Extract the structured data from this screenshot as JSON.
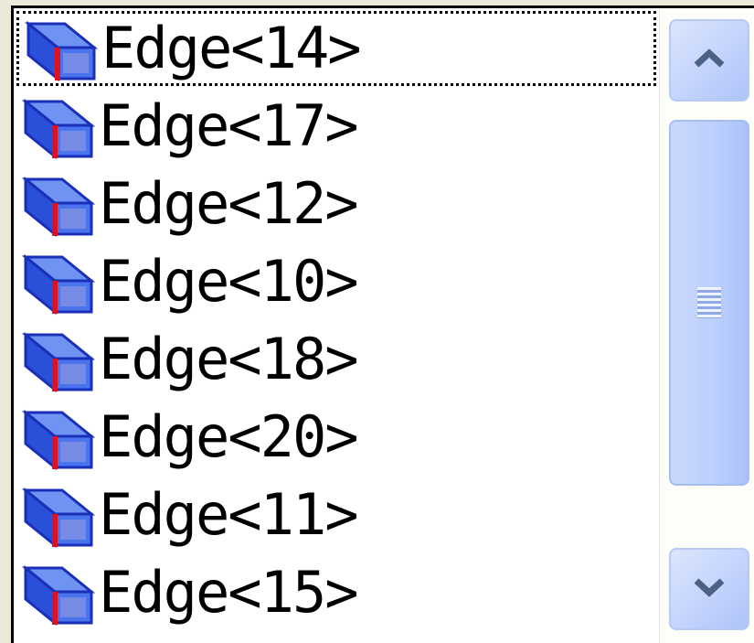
{
  "listbox": {
    "items": [
      {
        "label": "Edge<14>",
        "icon": "edge-block-icon",
        "focused": true
      },
      {
        "label": "Edge<17>",
        "icon": "edge-block-icon"
      },
      {
        "label": "Edge<12>",
        "icon": "edge-block-icon"
      },
      {
        "label": "Edge<10>",
        "icon": "edge-block-icon"
      },
      {
        "label": "Edge<18>",
        "icon": "edge-block-icon"
      },
      {
        "label": "Edge<20>",
        "icon": "edge-block-icon"
      },
      {
        "label": "Edge<11>",
        "icon": "edge-block-icon"
      },
      {
        "label": "Edge<15>",
        "icon": "edge-block-icon"
      }
    ]
  },
  "scrollbar": {
    "up_icon": "chevron-up-icon",
    "down_icon": "chevron-down-icon",
    "thumb_icon": "grip-icon"
  },
  "colors": {
    "window_bg": "#ece9d8",
    "list_bg": "#ffffff",
    "scroll_accent": "#c3d3fd",
    "icon_blue": "#2a4fd8",
    "icon_red": "#e01020"
  }
}
